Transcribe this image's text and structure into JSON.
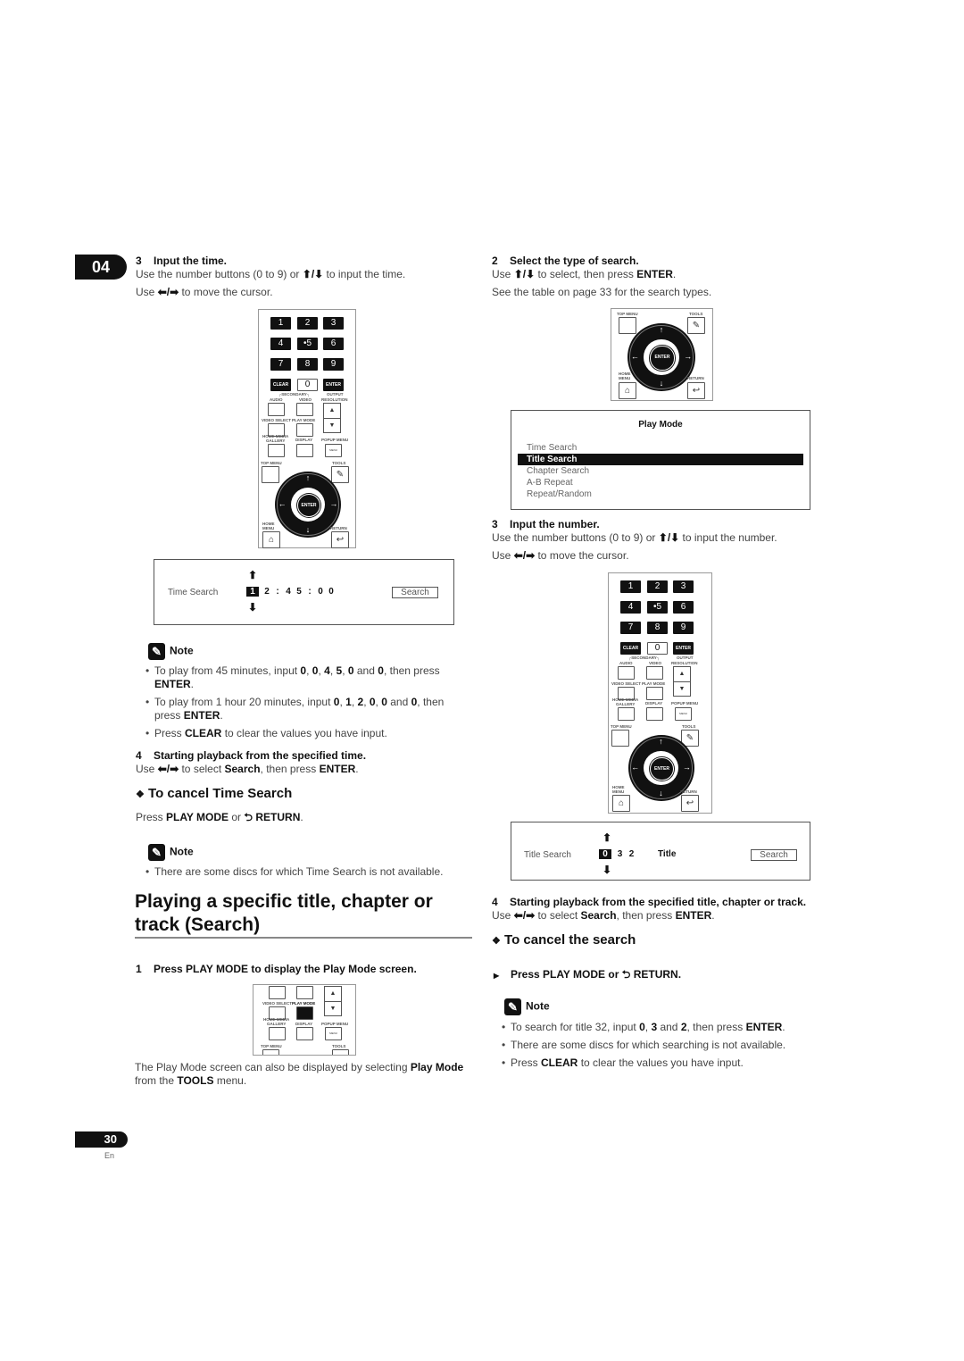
{
  "chapter_number": "04",
  "page": {
    "number": "30",
    "lang": "En"
  },
  "left": {
    "step3": {
      "num": "3",
      "title": "Input the time.",
      "line1": [
        "Use the number buttons (0 to 9) or ",
        "⬆/⬇",
        " to input the time."
      ],
      "line2": [
        "Use ",
        "⬅/➡",
        " to move the cursor."
      ]
    },
    "time_search_osd": {
      "label": "Time Search",
      "digits": [
        "1",
        "2",
        ":",
        "4",
        "5",
        ":",
        "0",
        "0"
      ],
      "cursor_index": 0,
      "button": "Search",
      "up_arrow": "⬆",
      "down_arrow": "⬇"
    },
    "note1": {
      "heading": "Note",
      "items": [
        {
          "parts": [
            [
              "To play from 45 minutes, input ",
              false
            ],
            [
              "0",
              true
            ],
            [
              ", ",
              false
            ],
            [
              "0",
              true
            ],
            [
              ", ",
              false
            ],
            [
              "4",
              true
            ],
            [
              ", ",
              false
            ],
            [
              "5",
              true
            ],
            [
              ", ",
              false
            ],
            [
              "0",
              true
            ],
            [
              " and ",
              false
            ],
            [
              "0",
              true
            ],
            [
              ", then press ",
              false
            ],
            [
              "ENTER",
              true
            ],
            [
              ".",
              false
            ]
          ]
        },
        {
          "parts": [
            [
              "To play from 1 hour 20 minutes, input ",
              false
            ],
            [
              "0",
              true
            ],
            [
              ", ",
              false
            ],
            [
              "1",
              true
            ],
            [
              ", ",
              false
            ],
            [
              "2",
              true
            ],
            [
              ", ",
              false
            ],
            [
              "0",
              true
            ],
            [
              ", ",
              false
            ],
            [
              "0",
              true
            ],
            [
              " and ",
              false
            ],
            [
              "0",
              true
            ],
            [
              ", then press ",
              false
            ],
            [
              "ENTER",
              true
            ],
            [
              ".",
              false
            ]
          ]
        },
        {
          "parts": [
            [
              "Press ",
              false
            ],
            [
              "CLEAR",
              true
            ],
            [
              " to clear the values you have input.",
              false
            ]
          ]
        }
      ]
    },
    "step4": {
      "num": "4",
      "title": "Starting playback from the specified time.",
      "line": [
        [
          "Use ",
          false
        ],
        [
          "⬅/➡",
          "arr"
        ],
        [
          " to select ",
          false
        ],
        [
          "Search",
          true
        ],
        [
          ", then press ",
          false
        ],
        [
          "ENTER",
          true
        ],
        [
          ".",
          false
        ]
      ]
    },
    "cancel_time": {
      "heading": "To cancel Time Search",
      "line": [
        [
          "Press ",
          false
        ],
        [
          "PLAY MODE",
          true
        ],
        [
          " or ",
          false
        ],
        [
          "RETURN",
          true
        ],
        [
          ".",
          false
        ]
      ]
    },
    "note2": {
      "heading": "Note",
      "items": [
        {
          "parts": [
            [
              "There are some discs for which Time Search is not available.",
              false
            ]
          ]
        }
      ]
    },
    "section_title_line1": "Playing a specific title, chapter or",
    "section_title_line2": "track (Search)",
    "step1": {
      "num": "1",
      "title": "Press PLAY MODE to display the Play Mode screen."
    },
    "play_mode_para": [
      [
        "The Play Mode screen can also be displayed by selecting ",
        false
      ],
      [
        "Play Mode",
        true
      ],
      [
        " from the ",
        false
      ],
      [
        "TOOLS",
        true
      ],
      [
        " menu.",
        false
      ]
    ]
  },
  "right": {
    "step2": {
      "num": "2",
      "title": "Select the type of search.",
      "line1": [
        [
          "Use ",
          false
        ],
        [
          "⬆/⬇",
          "arr"
        ],
        [
          " to select, then press ",
          false
        ],
        [
          "ENTER",
          true
        ],
        [
          ".",
          false
        ]
      ],
      "line2": "See the table on page 33 for the search types."
    },
    "play_mode_menu": {
      "title": "Play Mode",
      "items": [
        "Time Search",
        "Title Search",
        "Chapter Search",
        "A-B Repeat",
        "Repeat/Random"
      ],
      "selected_index": 1
    },
    "step3": {
      "num": "3",
      "title": "Input the number.",
      "line1": [
        "Use the number buttons (0 to 9) or ",
        "⬆/⬇",
        " to input the number."
      ],
      "line2": [
        "Use ",
        "⬅/➡",
        " to move the cursor."
      ]
    },
    "title_search_osd": {
      "label": "Title Search",
      "digits": [
        "0",
        "3",
        "2"
      ],
      "cursor_index": 0,
      "unit": "Title",
      "button": "Search",
      "up_arrow": "⬆",
      "down_arrow": "⬇"
    },
    "step4": {
      "num": "4",
      "title": "Starting playback from the specified title, chapter or track.",
      "line": [
        [
          "Use ",
          false
        ],
        [
          "⬅/➡",
          "arr"
        ],
        [
          " to select ",
          false
        ],
        [
          "Search",
          true
        ],
        [
          ", then press ",
          false
        ],
        [
          "ENTER",
          true
        ],
        [
          ".",
          false
        ]
      ]
    },
    "cancel_search": {
      "heading": "To cancel the search",
      "line": "Press PLAY MODE or",
      "line_end": "RETURN."
    },
    "note3": {
      "heading": "Note",
      "items": [
        {
          "parts": [
            [
              "To search for title 32, input ",
              false
            ],
            [
              "0",
              true
            ],
            [
              ", ",
              false
            ],
            [
              "3",
              true
            ],
            [
              " and ",
              false
            ],
            [
              "2",
              true
            ],
            [
              ", then press ",
              false
            ],
            [
              "ENTER",
              true
            ],
            [
              ".",
              false
            ]
          ]
        },
        {
          "parts": [
            [
              "There are some discs for which searching is not available.",
              false
            ]
          ]
        },
        {
          "parts": [
            [
              "Press ",
              false
            ],
            [
              "CLEAR",
              true
            ],
            [
              " to clear the values you have input.",
              false
            ]
          ]
        }
      ]
    }
  },
  "remote": {
    "numkeys": [
      "1",
      "2",
      "3",
      "4",
      "•5",
      "6",
      "7",
      "8",
      "9"
    ],
    "clear": "CLEAR",
    "zero": "0",
    "enter": "ENTER",
    "secondary": "┌SECONDARY┐",
    "audio": "AUDIO",
    "video": "VIDEO",
    "output_resolution": "OUTPUT RESOLUTION",
    "video_select": "VIDEO SELECT",
    "play_mode": "PLAY MODE",
    "home_media_gallery": "HOME MEDIA GALLERY",
    "display": "DISPLAY",
    "popup_menu": "POPUP MENU",
    "menu": "MENU",
    "top_menu": "TOP MENU",
    "tools": "TOOLS",
    "home_menu": "HOME MENU",
    "return": "RETURN",
    "icons": {
      "up": "▲",
      "down": "▼",
      "arrow_up": "🡅",
      "tools": "✎",
      "home": "⌂",
      "return": "↩"
    }
  },
  "symbols": {
    "diamond_bullet": "❖",
    "triangle_bullet": "▶",
    "note_icon": "✎",
    "return_icon": "⮌"
  }
}
